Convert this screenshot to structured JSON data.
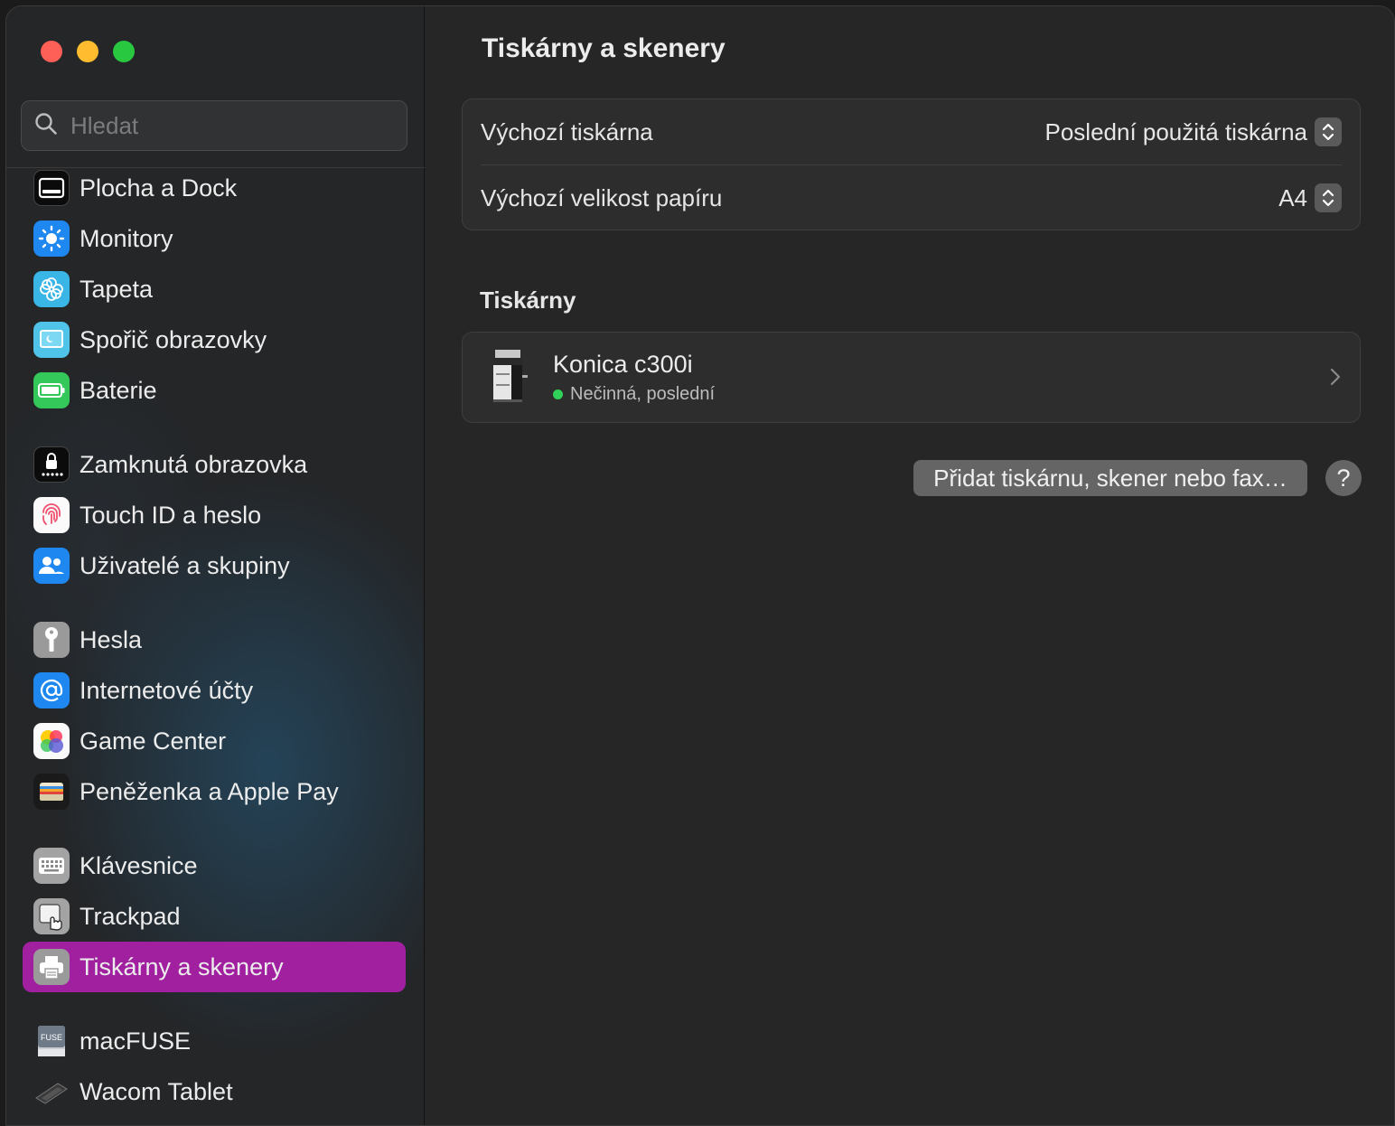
{
  "window": {
    "traffic_lights": {
      "close_color": "#fe5f57",
      "minimize_color": "#febc2e",
      "maximize_color": "#28c840"
    }
  },
  "sidebar": {
    "search": {
      "placeholder": "Hledat",
      "value": ""
    },
    "items": [
      {
        "label": "Plocha a Dock",
        "icon": "dock-icon",
        "selected": false
      },
      {
        "label": "Monitory",
        "icon": "display-icon",
        "selected": false
      },
      {
        "label": "Tapeta",
        "icon": "wallpaper-icon",
        "selected": false
      },
      {
        "label": "Spořič obrazovky",
        "icon": "screensaver-icon",
        "selected": false
      },
      {
        "label": "Baterie",
        "icon": "battery-icon",
        "selected": false
      },
      {
        "label": "Zamknutá obrazovka",
        "icon": "lock-screen-icon",
        "selected": false
      },
      {
        "label": "Touch ID a heslo",
        "icon": "fingerprint-icon",
        "selected": false
      },
      {
        "label": "Uživatelé a skupiny",
        "icon": "users-icon",
        "selected": false
      },
      {
        "label": "Hesla",
        "icon": "key-icon",
        "selected": false
      },
      {
        "label": "Internetové účty",
        "icon": "at-sign-icon",
        "selected": false
      },
      {
        "label": "Game Center",
        "icon": "game-center-icon",
        "selected": false
      },
      {
        "label": "Peněženka a Apple Pay",
        "icon": "wallet-icon",
        "selected": false
      },
      {
        "label": "Klávesnice",
        "icon": "keyboard-icon",
        "selected": false
      },
      {
        "label": "Trackpad",
        "icon": "trackpad-icon",
        "selected": false
      },
      {
        "label": "Tiskárny a skenery",
        "icon": "printer-icon",
        "selected": true
      },
      {
        "label": "macFUSE",
        "icon": "macfuse-icon",
        "icon_text": "FUSE",
        "selected": false
      },
      {
        "label": "Wacom Tablet",
        "icon": "wacom-tablet-icon",
        "selected": false
      }
    ],
    "selected_color": "#a020a0"
  },
  "main": {
    "title": "Tiskárny a skenery",
    "defaults": {
      "default_printer_label": "Výchozí tiskárna",
      "default_printer_value": "Poslední použitá tiskárna",
      "paper_size_label": "Výchozí velikost papíru",
      "paper_size_value": "A4"
    },
    "printers_heading": "Tiskárny",
    "printers": [
      {
        "name": "Konica c300i",
        "status": "Nečinná, poslední",
        "status_color": "#30d158",
        "icon": "printer-device-icon"
      }
    ],
    "add_button_label": "Přidat tiskárnu, skener nebo fax…",
    "help_button_label": "?"
  }
}
